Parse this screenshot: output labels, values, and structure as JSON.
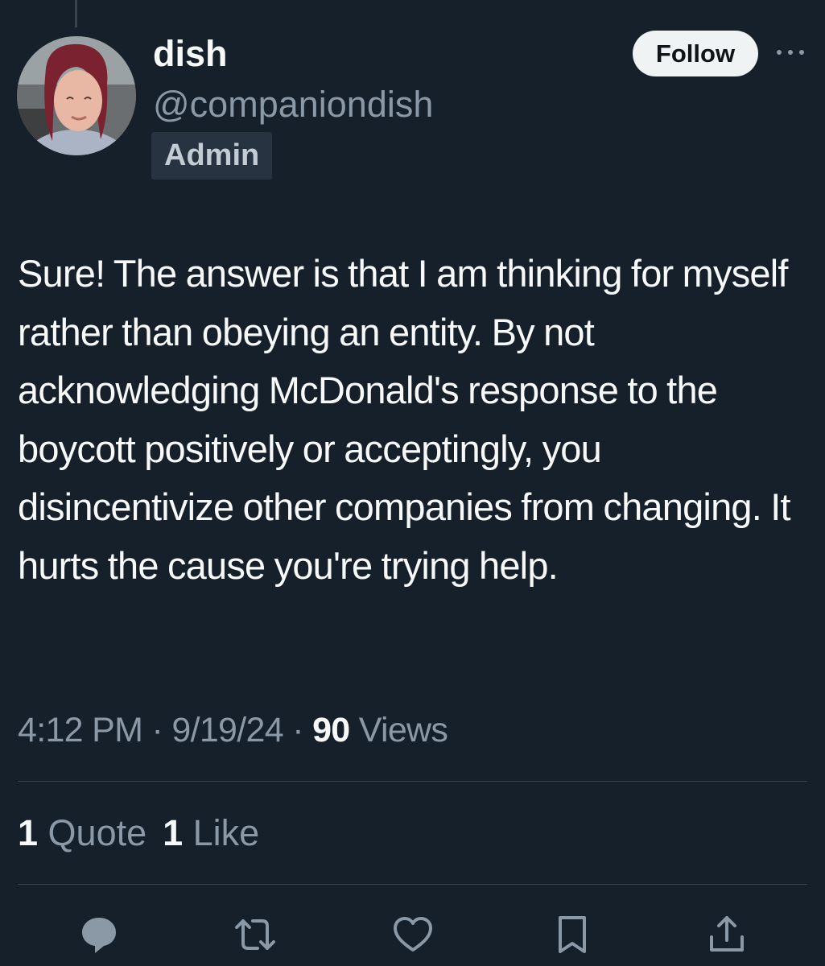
{
  "author": {
    "display_name": "dish",
    "handle": "@companiondish",
    "badge": "Admin",
    "avatar_icon": "profile-photo"
  },
  "header": {
    "follow_label": "Follow",
    "more_icon": "more-horizontal-icon"
  },
  "tweet": {
    "text": "Sure! The answer is that I am thinking for myself rather than obeying an entity. By not acknowledging McDonald's response to the boycott positively or acceptingly, you disincentivize other companies from changing. It hurts the cause you're trying help."
  },
  "meta": {
    "time": "4:12 PM",
    "sep1": " · ",
    "date": "9/19/24",
    "sep2": " · ",
    "views_count": "90",
    "views_label": " Views"
  },
  "stats": {
    "quotes_count": "1",
    "quotes_label": " Quote",
    "likes_count": "1",
    "likes_label": " Like"
  },
  "actions": {
    "reply_icon": "reply-icon",
    "retweet_icon": "retweet-icon",
    "like_icon": "like-heart-icon",
    "bookmark_icon": "bookmark-icon",
    "share_icon": "share-icon"
  },
  "colors": {
    "background": "#15202b",
    "text_primary": "#f7f9f9",
    "text_secondary": "#8b98a5",
    "divider": "#38444d",
    "follow_bg": "#eff3f4",
    "badge_bg": "#273340"
  }
}
